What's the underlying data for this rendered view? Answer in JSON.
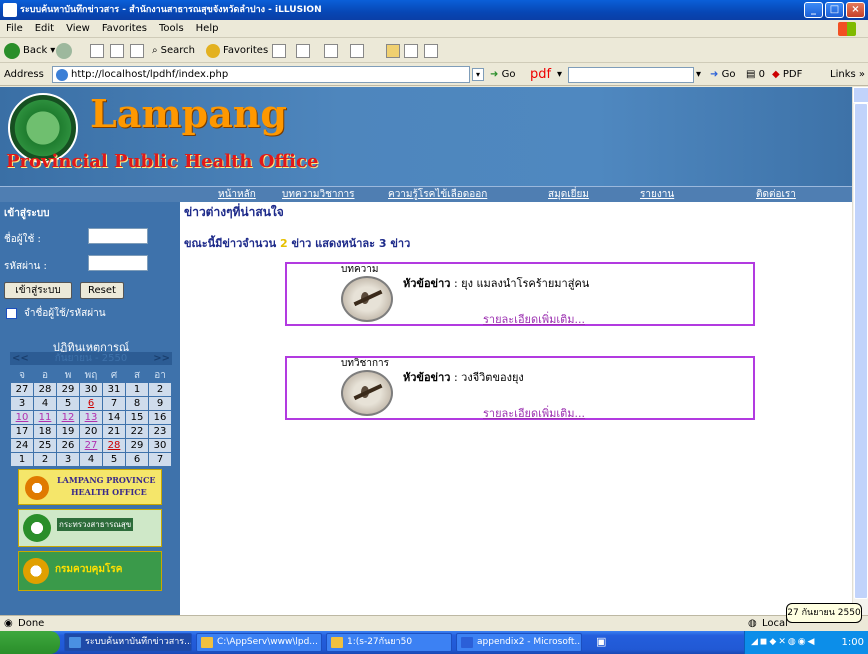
{
  "window": {
    "title": "ระบบค้นหาบันทึกข่าวสาร - สำนักงานสาธารณสุขจังหวัดลำปาง - iLLUSION"
  },
  "menu": [
    "File",
    "Edit",
    "View",
    "Favorites",
    "Tools",
    "Help"
  ],
  "toolbar": {
    "back": "Back",
    "search": "Search",
    "favorites": "Favorites"
  },
  "address": {
    "label": "Address",
    "url": "http://localhost/lpdhf/index.php",
    "go": "Go",
    "pdf": "pdf",
    "links": "Links",
    "go2": "Go",
    "pdf_btn": "PDF"
  },
  "banner": {
    "title": "Lampang",
    "subtitle": "Provincial Public Health Office"
  },
  "nav": [
    "หน้าหลัก",
    "บทความวิชาการ",
    "ความรู้โรคไข้เลือดออก",
    "สมุดเยี่ยม",
    "รายงาน",
    "ติดต่อเรา"
  ],
  "login": {
    "heading": "เข้าสู่ระบบ",
    "username_label": "ชื่อผู้ใช้ :",
    "password_label": "รหัสผ่าน :",
    "submit": "เข้าสู่ระบบ",
    "reset": "Reset",
    "remember": "จำชื่อผู้ใช้/รหัสผ่าน"
  },
  "calendar": {
    "title": "ปฏิทินเหตุการณ์",
    "month": "กันยายน - 2550",
    "prev": "<<",
    "next": ">>",
    "weekdays": [
      "จ",
      "อ",
      "พ",
      "พฤ",
      "ศ",
      "ส",
      "อา"
    ],
    "weeks": [
      [
        "27",
        "28",
        "29",
        "30",
        "31",
        "1",
        "2"
      ],
      [
        "3",
        "4",
        "5",
        "6",
        "7",
        "8",
        "9"
      ],
      [
        "10",
        "11",
        "12",
        "13",
        "14",
        "15",
        "16"
      ],
      [
        "17",
        "18",
        "19",
        "20",
        "21",
        "22",
        "23"
      ],
      [
        "24",
        "25",
        "26",
        "27",
        "28",
        "29",
        "30"
      ],
      [
        "1",
        "2",
        "3",
        "4",
        "5",
        "6",
        "7"
      ]
    ]
  },
  "banners": {
    "b1_line1": "LAMPANG PROVINCE",
    "b1_line2": "HEALTH OFFICE",
    "b2": "กระทรวงสาธารณสุข",
    "b3": "กรมควบคุมโรค"
  },
  "main": {
    "heading": "ข่าวต่างๆที่น่าสนใจ",
    "count_prefix": "ขณะนี้มีข่าวจำนวน",
    "count_value": "2",
    "count_suffix": "ข่าว แสดงหน้าละ 3 ข่าว",
    "headline_label": "หัวข้อข่าว",
    "more": "รายละเอียดเพิ่มเติม...",
    "items": [
      {
        "category": "บทความ",
        "title": ": ยุง แมลงนำโรคร้ายมาสู่คน"
      },
      {
        "category": "บทวิชาการ",
        "title": ": วงจีวิตของยุง"
      }
    ]
  },
  "status": {
    "text": "Done",
    "zone": "Local",
    "tooltip": "27 กันยายน 2550"
  },
  "taskbar": {
    "tasks": [
      "ระบบค้นหาบันทึกข่าวสาร...",
      "C:\\AppServ\\www\\lpd...",
      "1:(s-27กันยา50",
      "appendix2 - Microsoft..."
    ],
    "clock": "1:00"
  }
}
